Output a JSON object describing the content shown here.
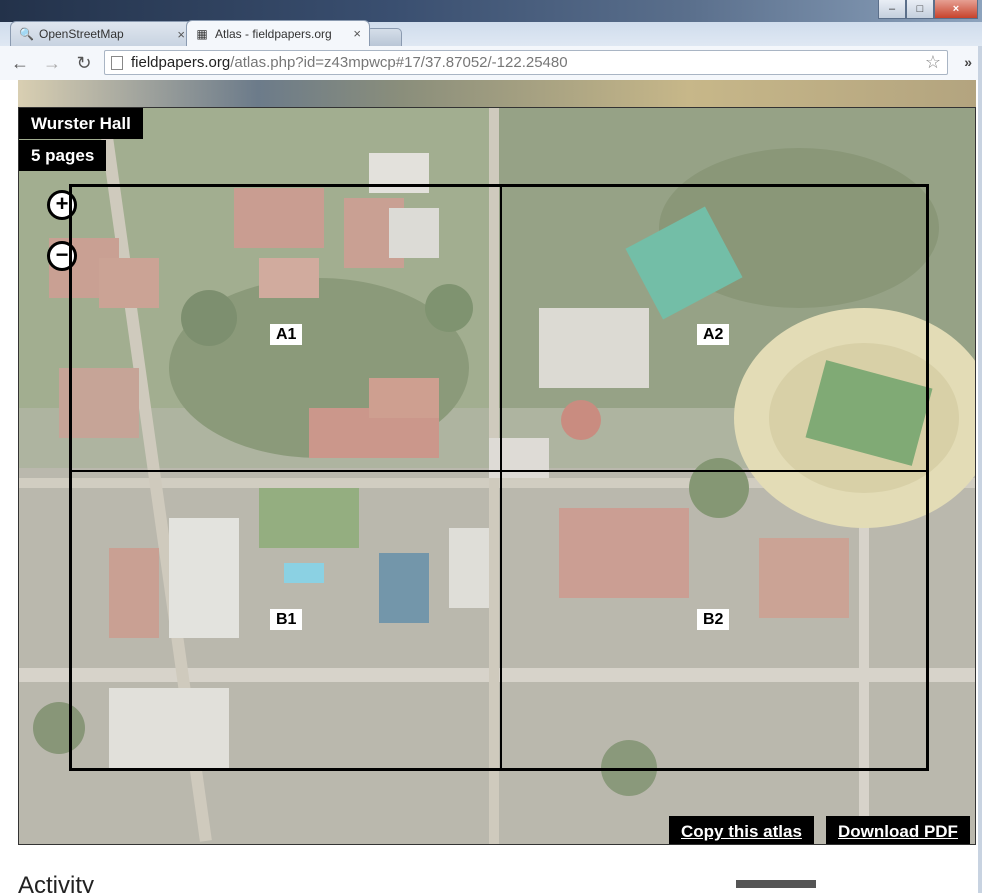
{
  "browser": {
    "tabs": [
      {
        "label": "OpenStreetMap",
        "favicon": "search-icon",
        "active": false
      },
      {
        "label": "Atlas - fieldpapers.org",
        "favicon": "atlas-icon",
        "active": true
      }
    ],
    "tab_close_glyph": "×",
    "url_host": "fieldpapers.org",
    "url_path": "/atlas.php?id=z43mpwcp#17/37.87052/-122.25480",
    "window_controls": {
      "minimize": "–",
      "maximize": "□",
      "close": "×"
    },
    "overflow": "»"
  },
  "atlas": {
    "title": "Wurster Hall",
    "pages_count": "5 pages",
    "zoom_in": "+",
    "zoom_out": "−",
    "cells": [
      "A1",
      "A2",
      "B1",
      "B2"
    ],
    "copy_button": "Copy this atlas",
    "download_button": "Download PDF"
  },
  "activity": {
    "heading": "Activity"
  },
  "colors": {
    "label_bg": "#000000",
    "label_fg": "#ffffff",
    "grid_line": "#000000"
  }
}
